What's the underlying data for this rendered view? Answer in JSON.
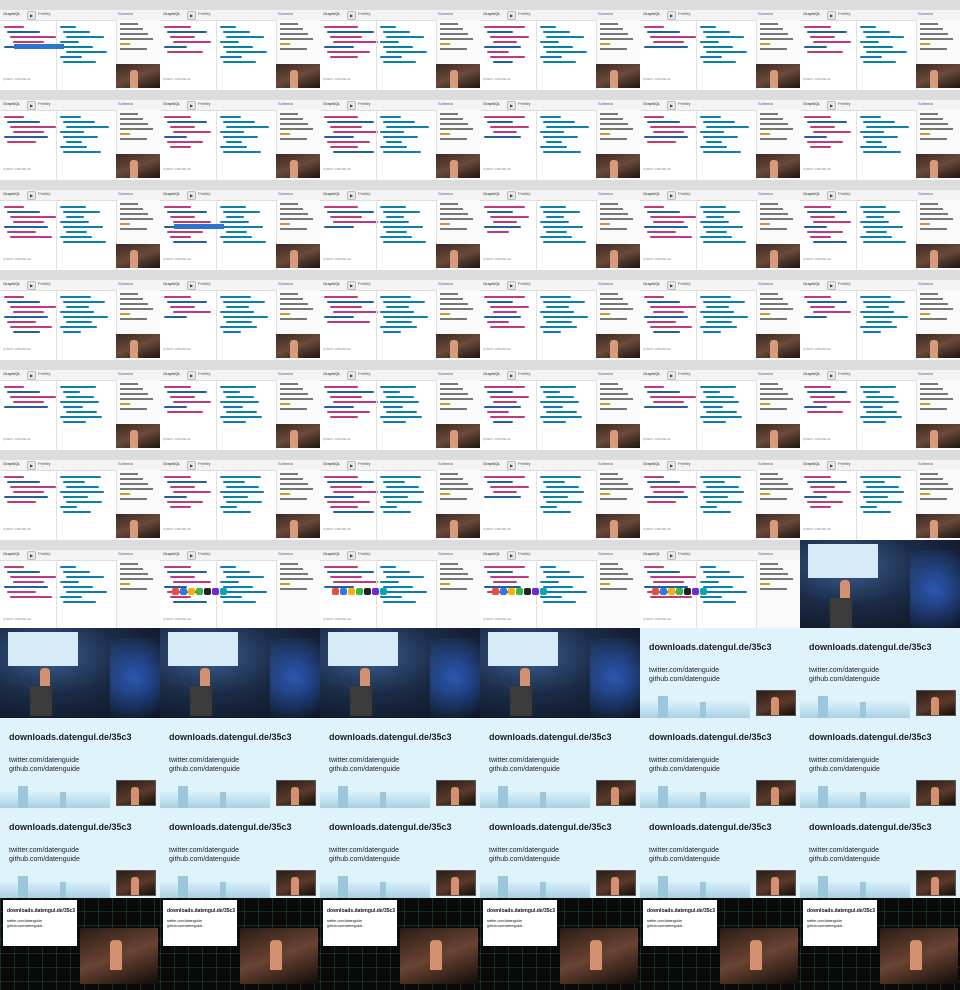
{
  "sheet": {
    "columns": 6,
    "rows": 11,
    "tile_layout": [
      [
        "graphiql",
        "graphiql",
        "graphiql",
        "graphiql",
        "graphiql",
        "graphiql"
      ],
      [
        "graphiql",
        "graphiql",
        "graphiql",
        "graphiql",
        "graphiql",
        "graphiql"
      ],
      [
        "graphiql",
        "graphiql",
        "graphiql",
        "graphiql",
        "graphiql",
        "graphiql"
      ],
      [
        "graphiql",
        "graphiql",
        "graphiql",
        "graphiql",
        "graphiql",
        "graphiql"
      ],
      [
        "graphiql",
        "graphiql",
        "graphiql",
        "graphiql",
        "graphiql",
        "graphiql"
      ],
      [
        "graphiql",
        "graphiql",
        "graphiql",
        "graphiql",
        "graphiql",
        "graphiql"
      ],
      [
        "graphiql",
        "graphiql",
        "graphiql",
        "graphiql",
        "graphiql",
        "stage"
      ],
      [
        "stage",
        "stage",
        "stage",
        "stage",
        "slide",
        "slide"
      ],
      [
        "slide",
        "slide",
        "slide",
        "slide",
        "slide",
        "slide"
      ],
      [
        "slide",
        "slide",
        "slide",
        "slide",
        "slide",
        "slide"
      ],
      [
        "circuit",
        "circuit",
        "circuit",
        "circuit",
        "circuit",
        "circuit"
      ]
    ]
  },
  "graphiql": {
    "app_title": "GraphiQL",
    "play_glyph": "▶",
    "prettify_label": "Prettify",
    "schema_label": "Schema",
    "variables_label": "QUERY VARIABLES",
    "accent_query": "#c0397b",
    "accent_result": "#0b7fad"
  },
  "slide": {
    "url": "downloads.datengul.de/35c3",
    "twitter": "twitter.com/datenguide",
    "github": "github.com/datenguide"
  }
}
